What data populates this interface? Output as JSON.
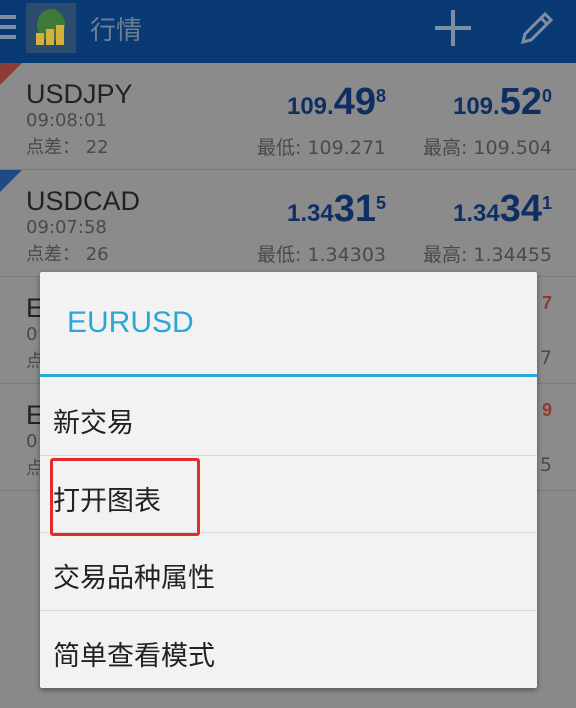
{
  "appbar": {
    "title": "行情"
  },
  "quotes": [
    {
      "symbol": "USDJPY",
      "time": "09:08:01",
      "spread_label": "点差：",
      "spread": "22",
      "bid": {
        "a": "109.",
        "b": "49",
        "c": "8"
      },
      "ask": {
        "a": "109.",
        "b": "52",
        "c": "0"
      },
      "low": "最低: 109.271",
      "high": "最高: 109.504",
      "corner": "red"
    },
    {
      "symbol": "USDCAD",
      "time": "09:07:58",
      "spread_label": "点差：",
      "spread": "26",
      "bid": {
        "a": "1.34",
        "b": "31",
        "c": "5"
      },
      "ask": {
        "a": "1.34",
        "b": "34",
        "c": "1"
      },
      "low": "最低: 1.34303",
      "high": "最高: 1.34455",
      "corner": "blue"
    },
    {
      "symbol": "E",
      "time": "0",
      "spread_label": "点",
      "spread": "",
      "tail_price": "7",
      "tail_high": "7"
    },
    {
      "symbol": "E",
      "time": "0",
      "spread_label": "点",
      "spread": "",
      "tail_price": "9",
      "tail_high": "5"
    }
  ],
  "dialog": {
    "title": "EURUSD",
    "items": [
      "新交易",
      "打开图表",
      "交易品种属性",
      "简单查看模式"
    ]
  },
  "colors": {
    "accent": "#29a8d8",
    "highlight": "#e22a2a",
    "appbar": "#0a3a73"
  }
}
